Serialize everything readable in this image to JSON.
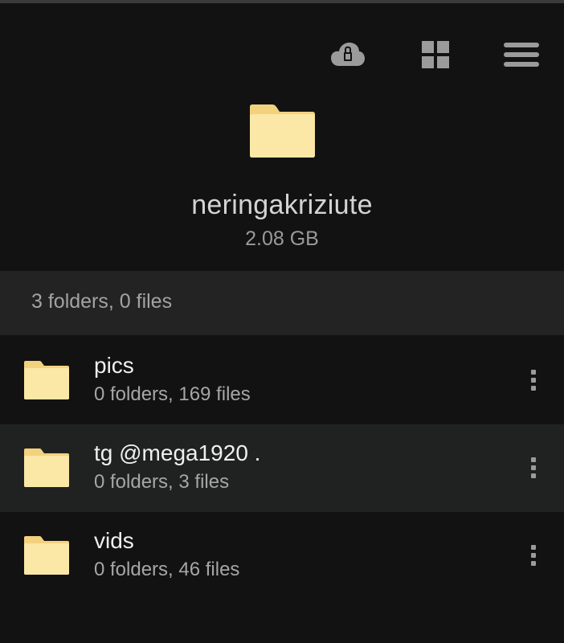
{
  "toolbar": {
    "cloud_icon": "cloud-lock-icon",
    "grid_icon": "grid-view-icon",
    "menu_icon": "hamburger-menu-icon"
  },
  "header": {
    "icon": "folder-icon",
    "name": "neringakriziute",
    "size": "2.08 GB"
  },
  "summary": {
    "text": "3 folders, 0 files"
  },
  "items": [
    {
      "name": "pics",
      "details": "0 folders, 169 files",
      "icon": "folder-icon"
    },
    {
      "name": "tg @mega1920 .",
      "details": "0 folders, 3 files",
      "icon": "folder-icon"
    },
    {
      "name": "vids",
      "details": "0 folders, 46 files",
      "icon": "folder-icon"
    }
  ],
  "colors": {
    "background": "#121212",
    "summary_bar": "#222322",
    "highlight_row": "#202221",
    "folder_fill": "#fbe4a0",
    "folder_tab": "#f7d98a",
    "icon_gray": "#9b9b9b"
  }
}
